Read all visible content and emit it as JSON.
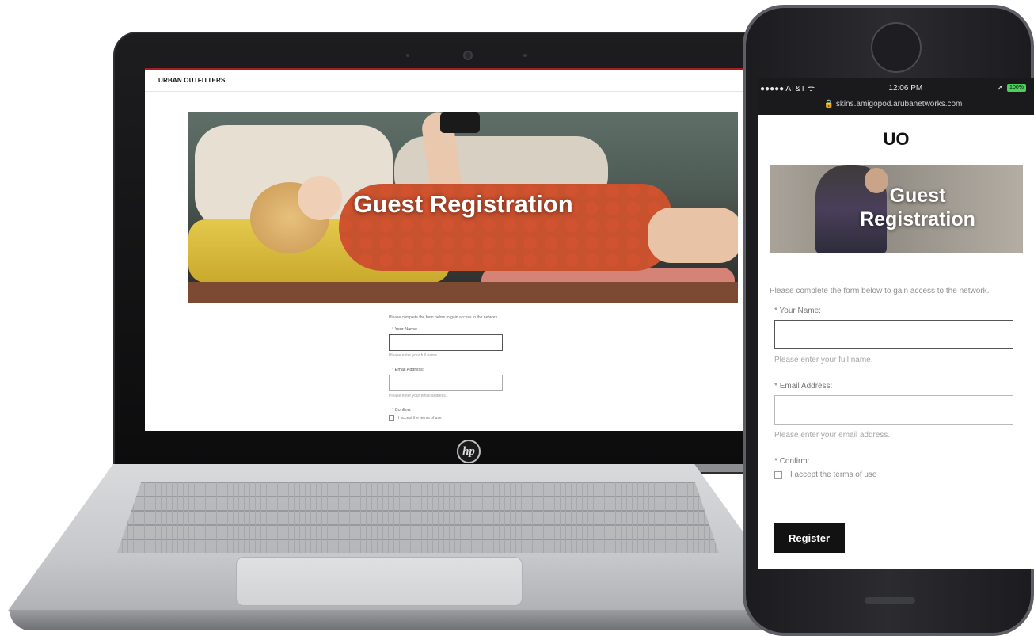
{
  "desktop": {
    "brand": "URBAN OUTFITTERS",
    "hero_title": "Guest Registration",
    "intro": "Please complete the form below to gain access to the network.",
    "name_label": "Your Name:",
    "name_hint": "Please enter your full name.",
    "email_label": "Email Address:",
    "email_hint": "Please enter your email address.",
    "confirm_label": "Confirm:",
    "terms_label": "I accept the terms of use",
    "required_marker": "*"
  },
  "laptop": {
    "logo_text": "hp"
  },
  "phone": {
    "status": {
      "carrier": "●●●●● AT&T ᯤ",
      "time": "12:06 PM",
      "battery": "100%",
      "url": "🔒 skins.amigopod.arubanetworks.com"
    },
    "brand": "UO",
    "hero_title_line1": "Guest",
    "hero_title_line2": "Registration",
    "intro": "Please complete the form below to gain access to the network.",
    "name_label": "Your Name:",
    "name_hint": "Please enter your full name.",
    "email_label": "Email Address:",
    "email_hint": "Please enter your email address.",
    "confirm_label": "Confirm:",
    "terms_label": "I accept the terms of use",
    "register_label": "Register",
    "required_marker": "*"
  },
  "colors": {
    "brand_red": "#a31f24",
    "register_bg": "#121212",
    "battery": "#4fd05a"
  }
}
